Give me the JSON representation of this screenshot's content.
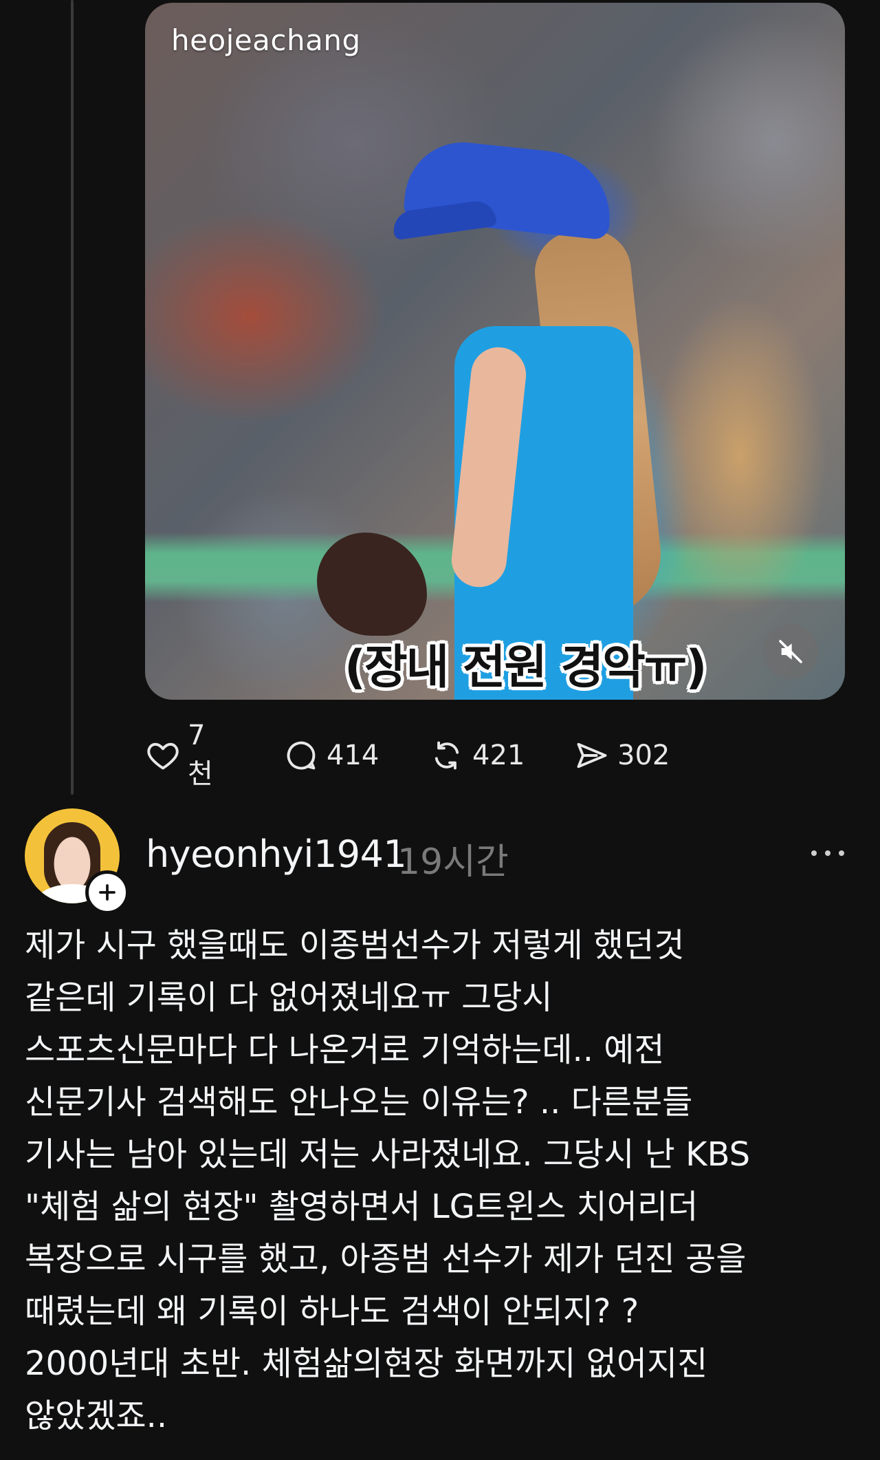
{
  "first_post": {
    "media": {
      "watermark": "heojeachang",
      "subtitle": "(장내 전원 경악ㅠ)",
      "mute_icon": "speaker-muted-icon"
    },
    "actions": {
      "likes": "7천",
      "comments": "414",
      "reposts": "421",
      "shares": "302"
    }
  },
  "reply": {
    "username": "hyeonhyi1941",
    "timestamp": "19시간",
    "body_lines": [
      "제가 시구 했을때도 이종범선수가  저렇게 했던것",
      "같은데 기록이 다 없어졌네요ㅠ 그당시",
      "스포츠신문마다 다 나온거로 기억하는데.. 예전",
      "신문기사 검색해도 안나오는 이유는? .. 다른분들",
      "기사는 남아 있는데 저는 사라졌네요. 그당시 난 KBS",
      "\"체험 삶의 현장\" 촬영하면서 LG트윈스 치어리더",
      "복장으로 시구를 했고, 아종범 선수가 제가 던진 공을",
      "때렸는데 왜 기록이 하나도 검색이 안되지? ?",
      "2000년대 초반. 체험삶의현장 화면까지 없어지진",
      "않았겠죠.."
    ]
  }
}
